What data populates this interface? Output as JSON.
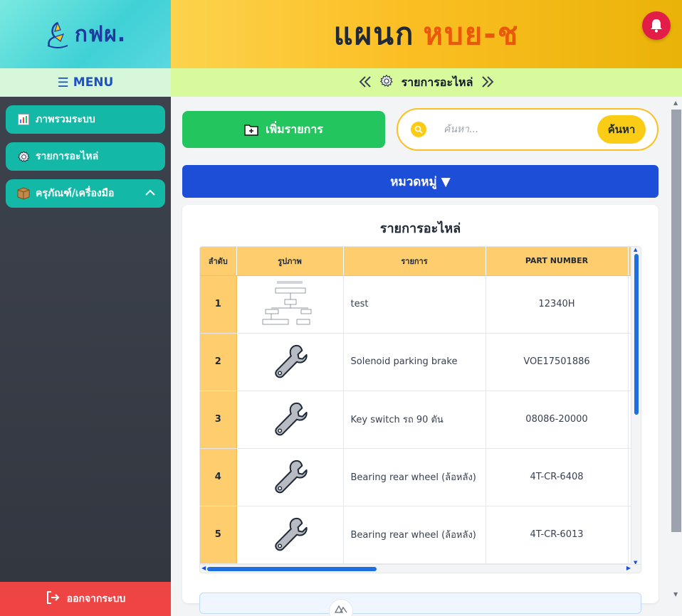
{
  "app": {
    "logo_text": "กฟผ.",
    "menu_label": "MENU",
    "header": {
      "dept": "แผนก",
      "unit": "หบย-ช"
    },
    "subbar_title": "รายการอะไหล่"
  },
  "sidebar": {
    "items": [
      {
        "label": "ภาพรวมระบบ",
        "icon": "chart-icon"
      },
      {
        "label": "รายการอะไหล่",
        "icon": "gear-icon"
      },
      {
        "label": "ครุภัณฑ์/เครื่องมือ",
        "icon": "box-icon"
      }
    ],
    "logout_label": "ออกจากระบบ"
  },
  "toolbar": {
    "add_label": "เพิ่มรายการ",
    "search_placeholder": "ค้นหา...",
    "search_button": "ค้นหา",
    "category_label": "หมวดหมู่ ▼"
  },
  "table": {
    "title": "รายการอะไหล่",
    "columns": [
      "ลำดับ",
      "รูปภาพ",
      "รายการ",
      "PART NUMBER"
    ],
    "rows": [
      {
        "no": "1",
        "name": "test",
        "part": "12340H",
        "image": "diagram-thumbnail"
      },
      {
        "no": "2",
        "name": "Solenoid parking brake",
        "part": "VOE17501886",
        "image": "wrench-icon"
      },
      {
        "no": "3",
        "name": "Key switch รถ 90 ตัน",
        "part": "08086-20000",
        "image": "wrench-icon"
      },
      {
        "no": "4",
        "name": "Bearing rear wheel (ล้อหลัง)",
        "part": "4T-CR-6408",
        "image": "wrench-icon"
      },
      {
        "no": "5",
        "name": "Bearing rear wheel (ล้อหลัง)",
        "part": "4T-CR-6013",
        "image": "wrench-icon"
      }
    ]
  },
  "colors": {
    "header_gold": "#fbbf24",
    "sidebar_teal": "#14b8a6",
    "add_green": "#22c55e",
    "category_blue": "#1d4ed8",
    "logout_red": "#ef4444",
    "table_header": "#fdcd6e"
  }
}
